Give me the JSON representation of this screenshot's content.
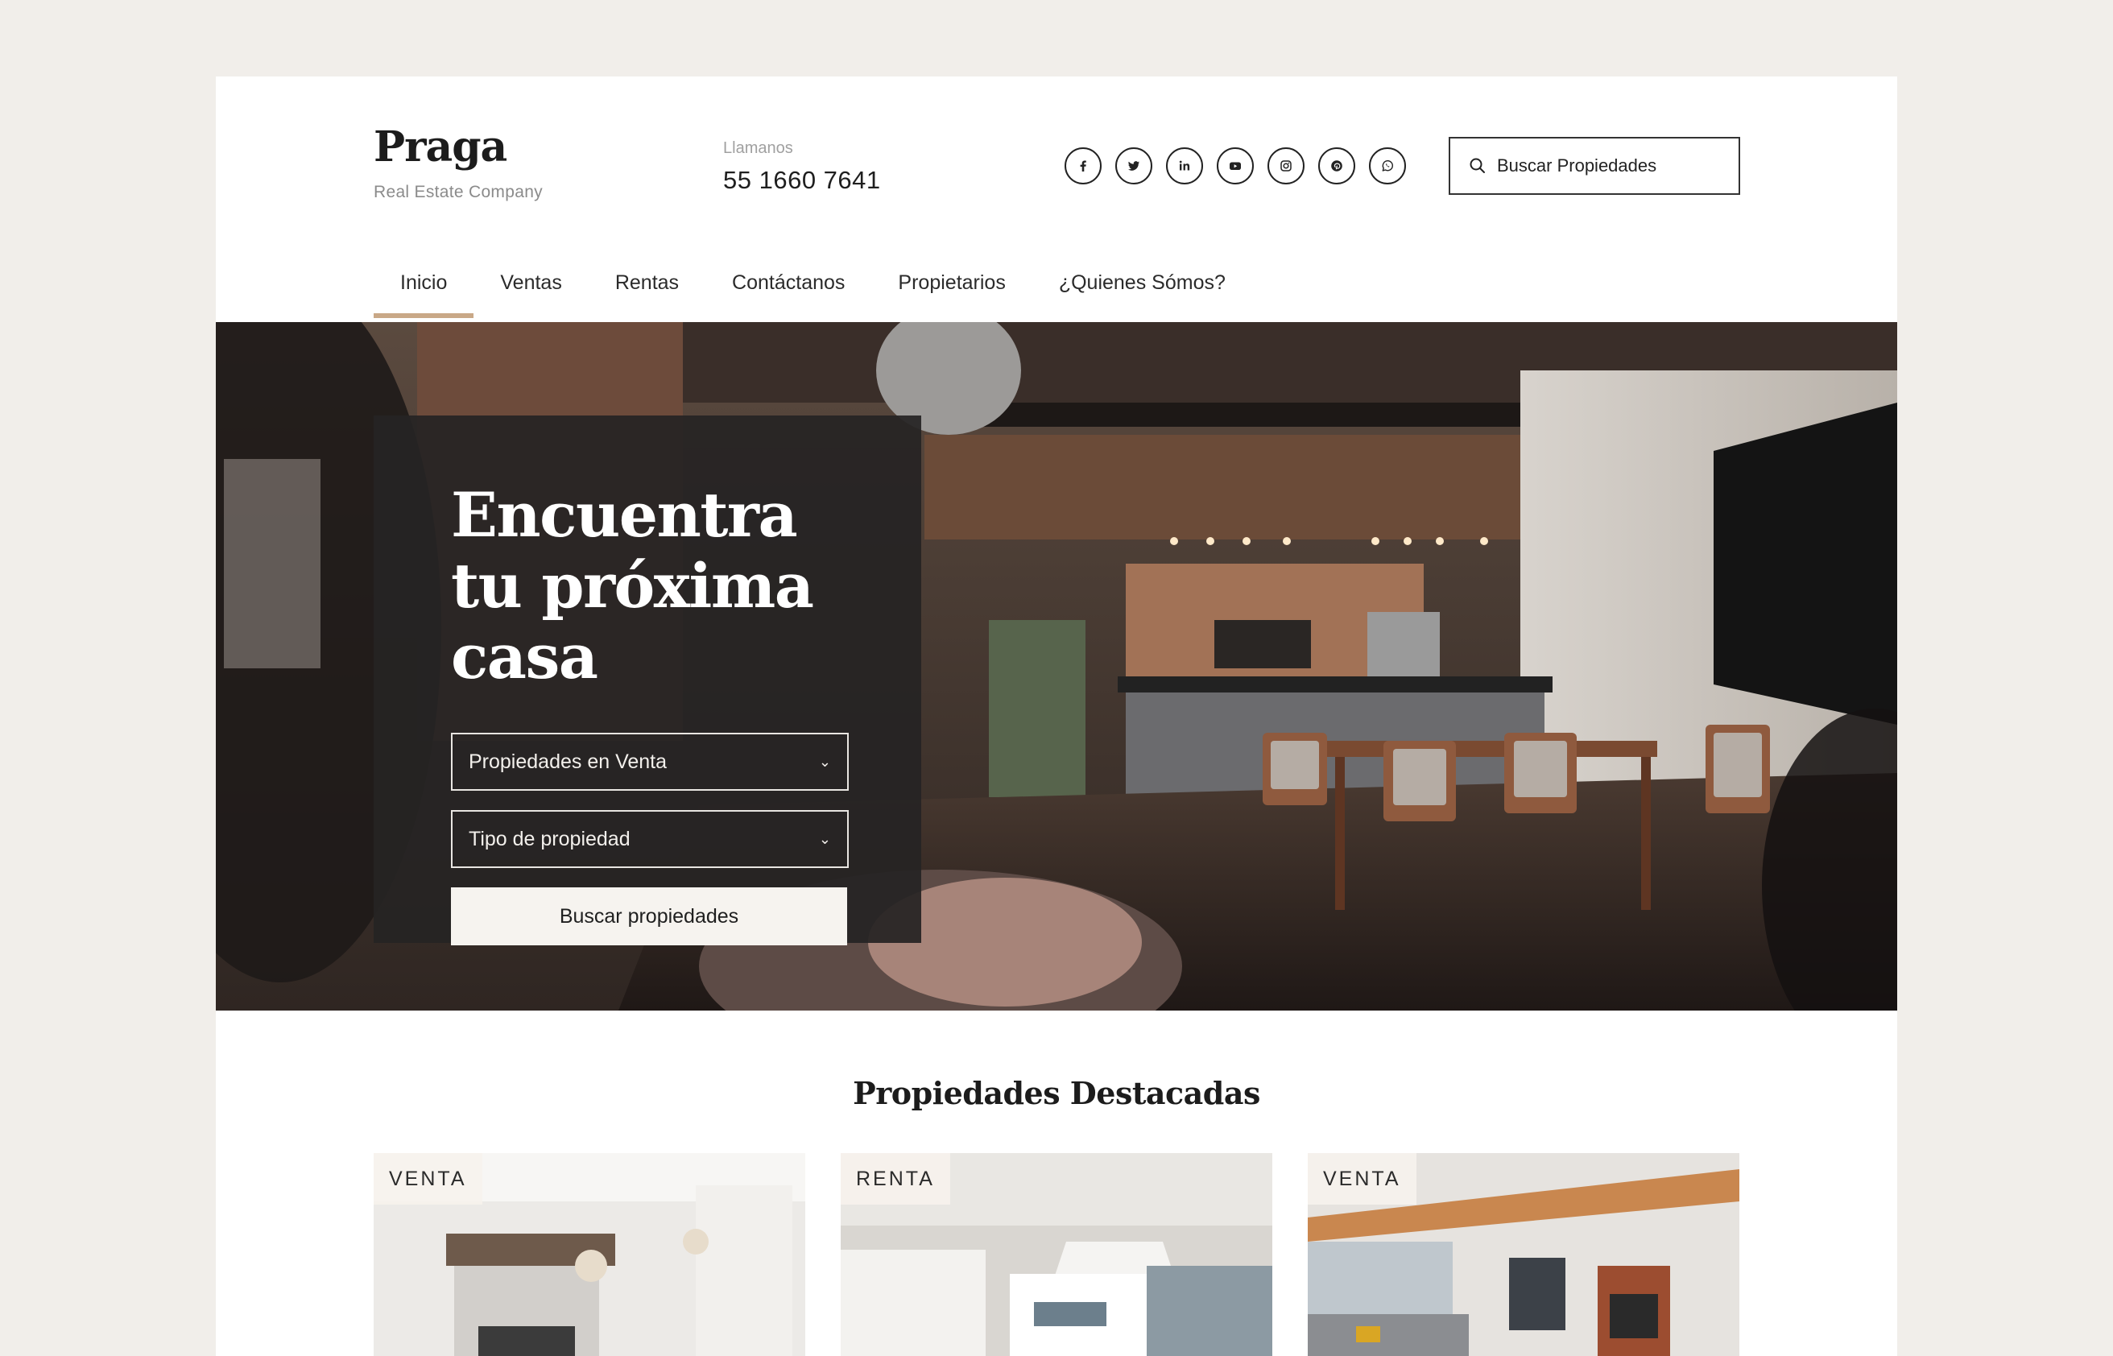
{
  "brand": {
    "name": "Praga",
    "tagline": "Real Estate Company"
  },
  "contact": {
    "label": "Llamanos",
    "phone": "55 1660 7641"
  },
  "social": [
    "facebook-icon",
    "twitter-icon",
    "linkedin-icon",
    "youtube-icon",
    "instagram-icon",
    "pinterest-icon",
    "whatsapp-icon"
  ],
  "search": {
    "placeholder": "Buscar Propiedades"
  },
  "nav": {
    "items": [
      {
        "label": "Inicio",
        "active": true
      },
      {
        "label": "Ventas"
      },
      {
        "label": "Rentas"
      },
      {
        "label": "Contáctanos"
      },
      {
        "label": "Propietarios"
      },
      {
        "label": "¿Quienes Sómos?"
      }
    ]
  },
  "hero": {
    "title": "Encuentra tu próxima casa",
    "operation_select": "Propiedades en Venta",
    "type_select": "Tipo de propiedad",
    "button": "Buscar propiedades"
  },
  "featured": {
    "title": "Propiedades Destacadas",
    "cards": [
      {
        "badge": "VENTA"
      },
      {
        "badge": "RENTA"
      },
      {
        "badge": "VENTA"
      }
    ]
  },
  "colors": {
    "accent": "#c9a887",
    "background": "#f1eeea",
    "card": "#262423"
  }
}
